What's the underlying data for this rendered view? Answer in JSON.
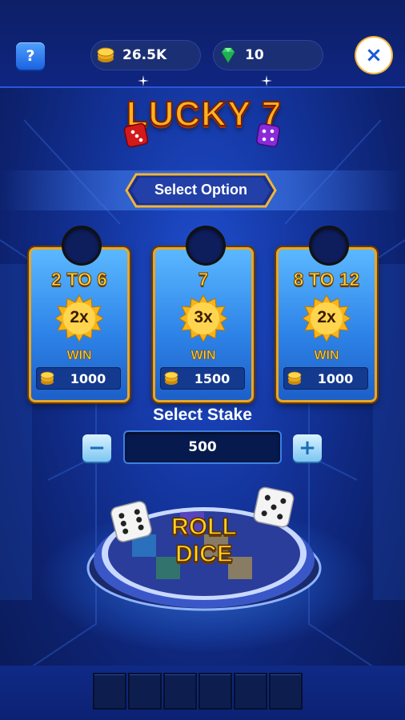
{
  "topbar": {
    "help_label": "?",
    "coins": "26.5K",
    "gems": "10",
    "close_label": "×"
  },
  "title": "LUCKY 7",
  "select_option_label": "Select Option",
  "options": [
    {
      "range": "2 TO 6",
      "multiplier": "2x",
      "win_label": "WIN",
      "amount": "1000"
    },
    {
      "range": "7",
      "multiplier": "3x",
      "win_label": "WIN",
      "amount": "1500"
    },
    {
      "range": "8 TO 12",
      "multiplier": "2x",
      "win_label": "WIN",
      "amount": "1000"
    }
  ],
  "stake": {
    "title": "Select Stake",
    "minus_label": "−",
    "value": "500",
    "plus_label": "+"
  },
  "roll_button": {
    "line1": "ROLL",
    "line2": "DICE"
  },
  "colors": {
    "background": "#1436a0",
    "card_border": "#e7a72b",
    "gold_text": "#ffd23a",
    "accent_blue": "#1a5bd9"
  },
  "icons": [
    "help-icon",
    "coin-icon",
    "gem-icon",
    "close-icon",
    "red-die-icon",
    "purple-die-icon",
    "white-die-icon"
  ]
}
